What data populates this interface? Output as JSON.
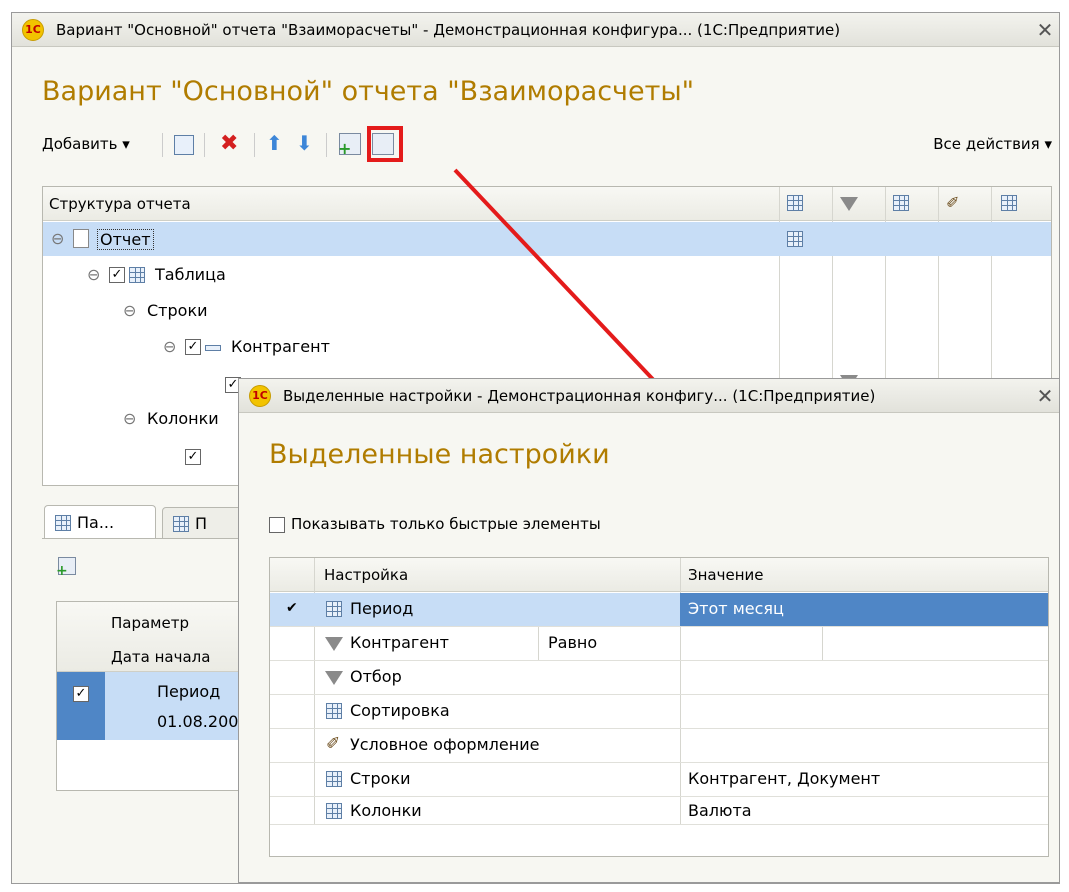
{
  "main_window": {
    "title": "Вариант \"Основной\" отчета \"Взаиморасчеты\" - Демонстрационная конфигура... (1С:Предприятие)",
    "heading": "Вариант \"Основной\" отчета \"Взаиморасчеты\"",
    "logo": "1c",
    "toolbar": {
      "add_label": "Добавить ▾",
      "all_actions_label": "Все действия ▾"
    },
    "structure": {
      "header": "Структура отчета",
      "items": [
        {
          "label": "Отчет"
        },
        {
          "label": "Таблица"
        },
        {
          "label": "Строки"
        },
        {
          "label": "Контрагент"
        },
        {
          "label": "Колонки"
        }
      ]
    },
    "tabs": [
      "Па...",
      "П"
    ],
    "params": {
      "col_param": "Параметр",
      "col_start": "Дата начала",
      "row_name": "Период",
      "row_date": "01.08.200"
    }
  },
  "dialog": {
    "title": "Выделенные настройки - Демонстрационная конфигу... (1С:Предприятие)",
    "heading": "Выделенные настройки",
    "show_fast_only": "Показывать только быстрые элементы",
    "columns": {
      "setting": "Настройка",
      "value": "Значение"
    },
    "rows": [
      {
        "check": "✔",
        "icon": "period-icon",
        "name": "Период",
        "cond": "",
        "value": "Этот месяц"
      },
      {
        "check": "",
        "icon": "filter-icon",
        "name": "Контрагент",
        "cond": "Равно",
        "value": ""
      },
      {
        "check": "",
        "icon": "filter-icon",
        "name": "Отбор",
        "cond": "",
        "value": ""
      },
      {
        "check": "",
        "icon": "sort-icon",
        "name": "Сортировка",
        "cond": "",
        "value": ""
      },
      {
        "check": "",
        "icon": "conditional-format-icon",
        "name": "Условное оформление",
        "cond": "",
        "value": ""
      },
      {
        "check": "",
        "icon": "grid-icon",
        "name": "Строки",
        "cond": "",
        "value": "Контрагент, Документ"
      },
      {
        "check": "",
        "icon": "grid-icon",
        "name": "Колонки",
        "cond": "",
        "value": "Валюта"
      }
    ]
  },
  "colors": {
    "accent_heading": "#b07c00",
    "selection": "#4f86c6",
    "highlight": "#e41b1b",
    "arrow": "#e41b1b"
  }
}
